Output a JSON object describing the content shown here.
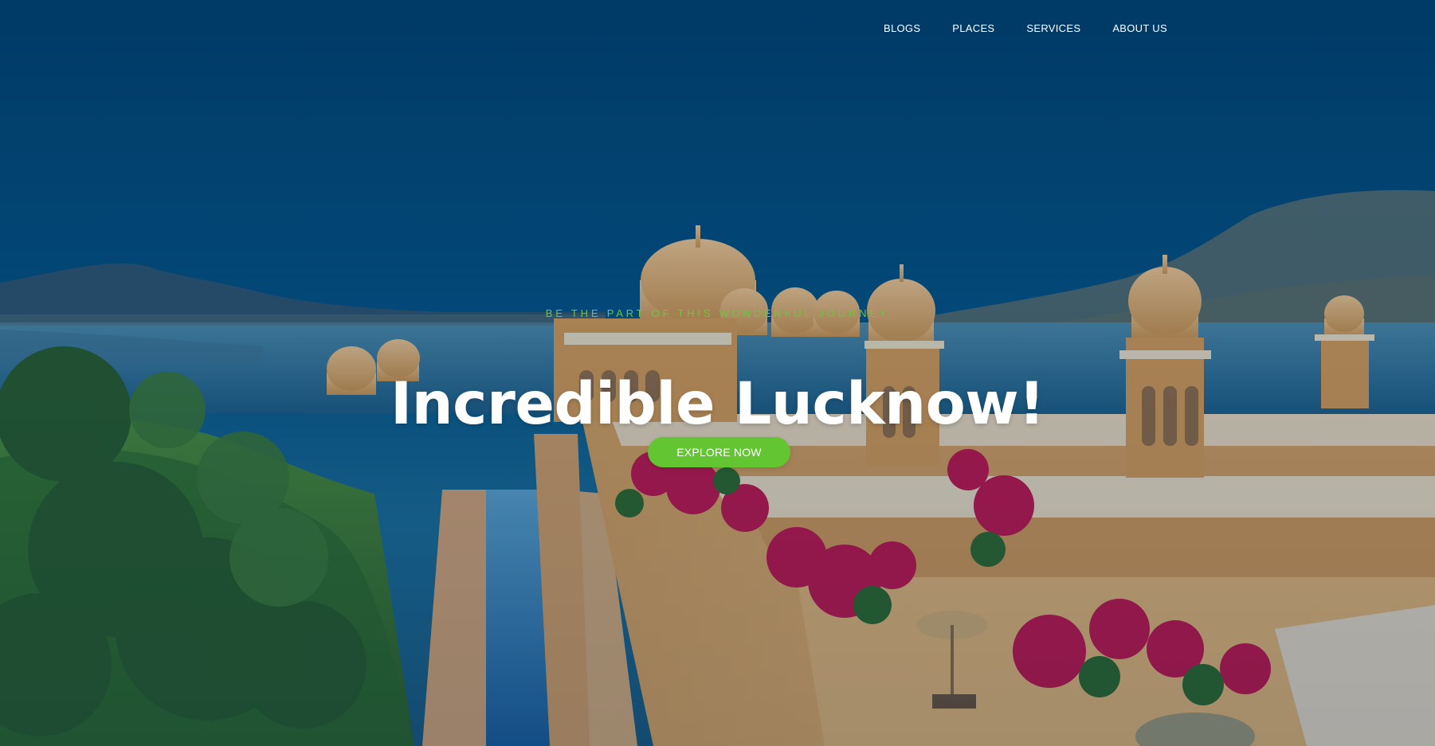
{
  "colors": {
    "accent": "#62c531",
    "tagline": "#6cc53e",
    "overlay_top": "#00457a",
    "text": "#ffffff"
  },
  "nav": {
    "items": [
      {
        "label": "BLOGS"
      },
      {
        "label": "PLACES"
      },
      {
        "label": "SERVICES"
      },
      {
        "label": "ABOUT US"
      }
    ]
  },
  "hero": {
    "tagline": "BE THE PART OF THIS WONDERFUL JOURNEY",
    "title": "Incredible Lucknow!",
    "cta_label": "EXPLORE NOW"
  }
}
